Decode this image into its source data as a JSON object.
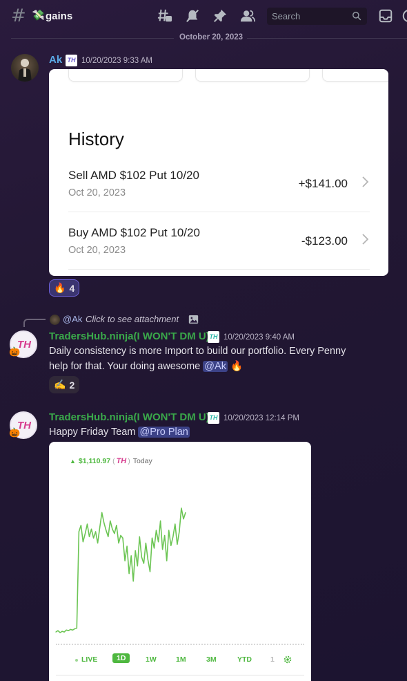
{
  "header": {
    "channel_emoji": "💸",
    "channel_name": "gains",
    "search_placeholder": "Search",
    "icons": [
      "threads-icon",
      "mute-icon",
      "pin-icon",
      "members-icon",
      "search-icon",
      "inbox-icon"
    ]
  },
  "divider": {
    "date": "October 20, 2023"
  },
  "messages": [
    {
      "author": "Ak",
      "author_color": "#5aa9e6",
      "badge": "TH",
      "timestamp": "10/20/2023 9:33 AM",
      "attachment": {
        "title": "History",
        "rows": [
          {
            "desc": "Sell AMD $102 Put 10/20",
            "date": "Oct 20, 2023",
            "amount": "+$141.00"
          },
          {
            "desc": "Buy AMD $102 Put 10/20",
            "date": "Oct 20, 2023",
            "amount": "-$123.00"
          }
        ]
      },
      "reaction": {
        "emoji": "🔥",
        "count": "4"
      }
    },
    {
      "reply": {
        "mention": "@Ak",
        "text": "Click to see attachment"
      },
      "author": "TradersHub.ninja(I WON'T DM U)",
      "author_color": "#3aa84a",
      "badge": "TH",
      "timestamp": "10/20/2023 9:40 AM",
      "text_line1": "Daily consistency is more Import to build our portfolio. Every Penny",
      "text_line2_prefix": "help for that. Your doing awesome ",
      "mention": "@Ak",
      "trail_emoji": "🔥",
      "reaction": {
        "emoji": "✍️",
        "count": "2"
      }
    },
    {
      "author": "TradersHub.ninja(I WON'T DM U)",
      "author_color": "#3aa84a",
      "badge": "TH",
      "timestamp": "10/20/2023 12:14 PM",
      "text_prefix": "Happy Friday Team ",
      "mention": "@Pro Plan",
      "attachment": {
        "header_value": "$1,110.97",
        "header_paren_open": "(",
        "header_logo": "TH",
        "header_paren_close": ")",
        "header_suffix": "Today",
        "ranges": [
          "LIVE",
          "1D",
          "1W",
          "1M",
          "3M",
          "YTD",
          "1"
        ],
        "selected_range": "1D"
      }
    }
  ],
  "chart_data": {
    "type": "line",
    "title": "",
    "xlabel": "",
    "ylabel": "",
    "series": [
      {
        "values": [
          0,
          2,
          -1,
          1,
          0,
          3,
          2,
          4,
          3,
          5,
          6,
          158,
          168,
          142,
          155,
          170,
          150,
          162,
          148,
          158,
          140,
          165,
          188,
          172,
          160,
          150,
          175,
          162,
          155,
          168,
          140,
          152,
          148,
          112,
          135,
          92,
          120,
          80,
          128,
          104,
          150,
          118,
          108,
          140,
          114,
          95,
          148,
          132,
          160,
          142,
          175,
          130,
          152,
          112,
          160,
          136,
          150,
          170,
          138,
          158,
          195,
          178,
          188
        ]
      }
    ],
    "color": "#6cc554"
  }
}
